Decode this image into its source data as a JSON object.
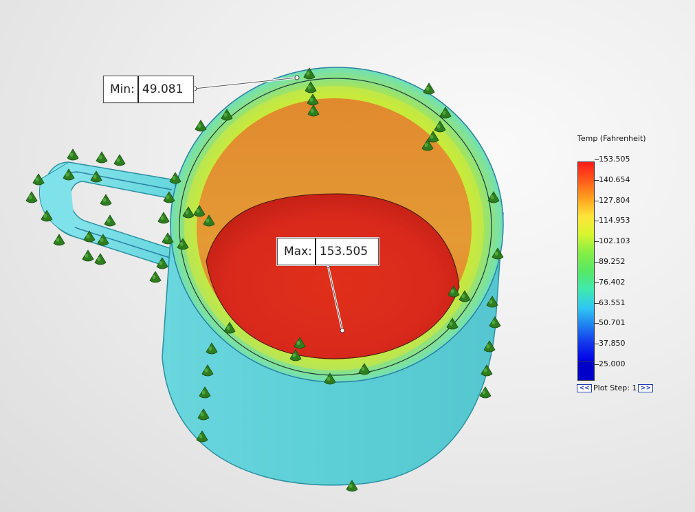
{
  "probes": {
    "min": {
      "label": "Min:",
      "value": "49.081"
    },
    "max": {
      "label": "Max:",
      "value": "153.505"
    }
  },
  "legend": {
    "title": "Temp (Fahrenheit)",
    "ticks": [
      "153.505",
      "140.654",
      "127.804",
      "114.953",
      "102.103",
      "89.252",
      "76.402",
      "63.551",
      "50.701",
      "37.850",
      "25.000"
    ],
    "scale_max": 153.505,
    "scale_min": 25.0,
    "colors": {
      "max": "#ff1a1a",
      "high": "#ffa01e",
      "mid": "#d9f530",
      "midlow": "#55e868",
      "low": "#2fc8f2",
      "min": "#0000e6"
    }
  },
  "plot_step": {
    "prev_label": "<<",
    "label": "Plot Step: 1",
    "next_label": ">>"
  },
  "icons": {
    "heat_load_markers": "green-cone-arrow-icon"
  }
}
